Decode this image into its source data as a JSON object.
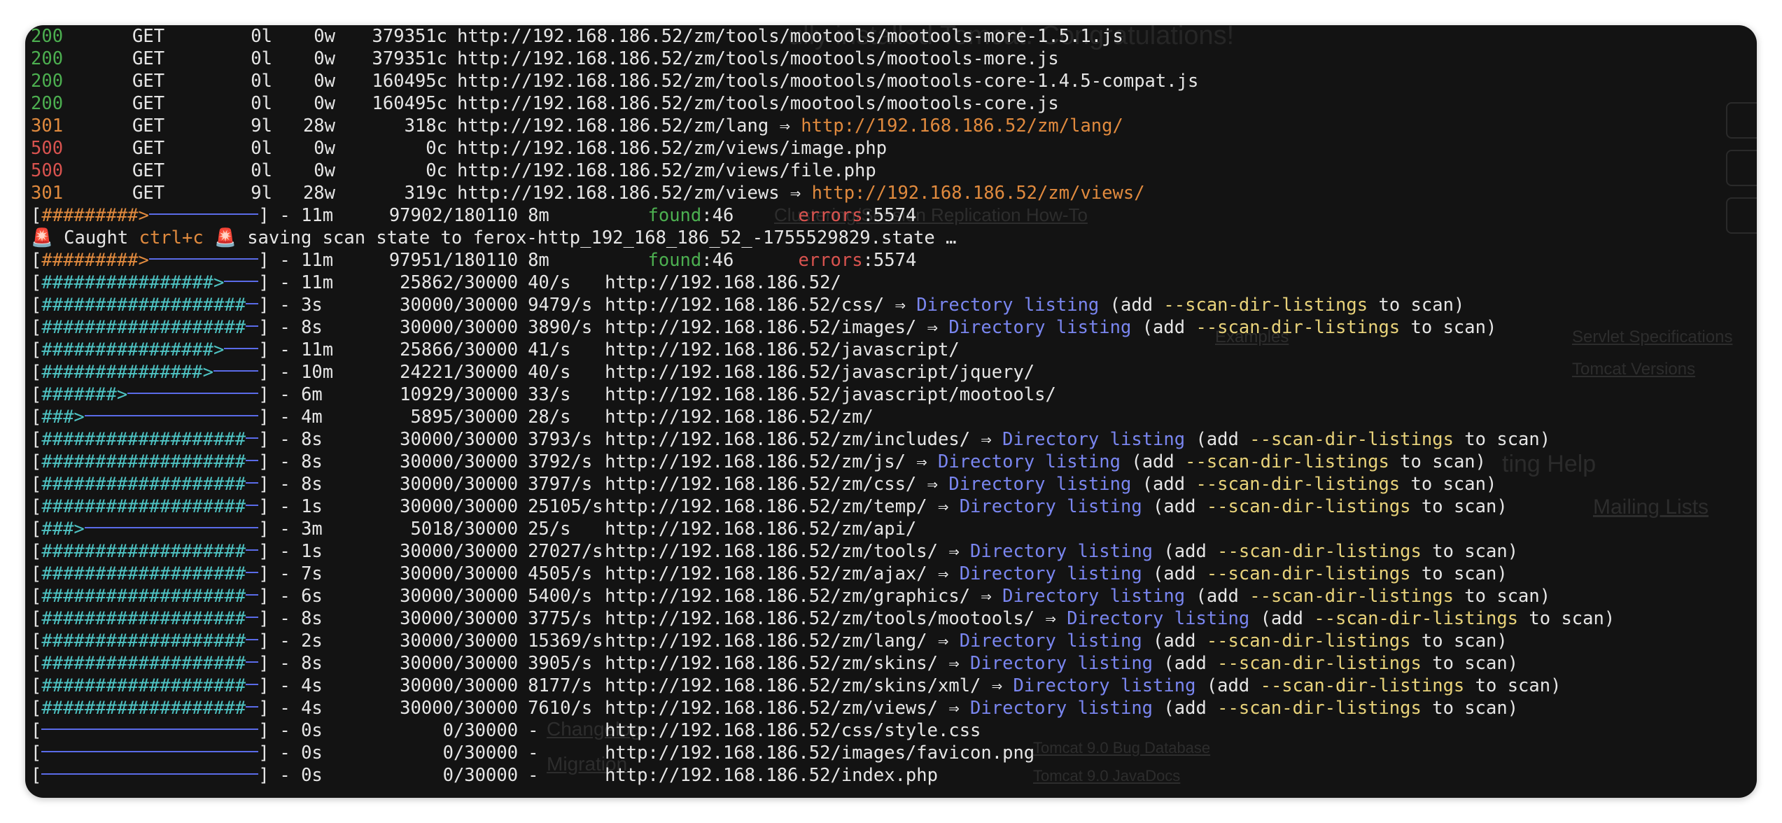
{
  "status_lines": [
    {
      "status": "200",
      "method": "GET",
      "lines": "0l",
      "words": "0w",
      "chars": "379351c",
      "url": "http://192.168.186.52/zm/tools/mootools/mootools-more-1.5.1.js",
      "redirect": ""
    },
    {
      "status": "200",
      "method": "GET",
      "lines": "0l",
      "words": "0w",
      "chars": "379351c",
      "url": "http://192.168.186.52/zm/tools/mootools/mootools-more.js",
      "redirect": ""
    },
    {
      "status": "200",
      "method": "GET",
      "lines": "0l",
      "words": "0w",
      "chars": "160495c",
      "url": "http://192.168.186.52/zm/tools/mootools/mootools-core-1.4.5-compat.js",
      "redirect": ""
    },
    {
      "status": "200",
      "method": "GET",
      "lines": "0l",
      "words": "0w",
      "chars": "160495c",
      "url": "http://192.168.186.52/zm/tools/mootools/mootools-core.js",
      "redirect": ""
    },
    {
      "status": "301",
      "method": "GET",
      "lines": "9l",
      "words": "28w",
      "chars": "318c",
      "url": "http://192.168.186.52/zm/lang",
      "redirect": "http://192.168.186.52/zm/lang/"
    },
    {
      "status": "500",
      "method": "GET",
      "lines": "0l",
      "words": "0w",
      "chars": "0c",
      "url": "http://192.168.186.52/zm/views/image.php",
      "redirect": ""
    },
    {
      "status": "500",
      "method": "GET",
      "lines": "0l",
      "words": "0w",
      "chars": "0c",
      "url": "http://192.168.186.52/zm/views/file.php",
      "redirect": ""
    },
    {
      "status": "301",
      "method": "GET",
      "lines": "9l",
      "words": "28w",
      "chars": "319c",
      "url": "http://192.168.186.52/zm/views",
      "redirect": "http://192.168.186.52/zm/views/"
    }
  ],
  "arrow": "⇒",
  "overall_1": {
    "bar_hash": "#########>",
    "bar_fraction": 0.54,
    "time": "11m",
    "count": "97902/180110",
    "rate": "8m",
    "found_label": "found",
    "found": "46",
    "errors_label": "errors",
    "errors": "5574"
  },
  "caught": {
    "siren": "🚨",
    "pre": " Caught ",
    "keys": "ctrl+c",
    "post": " saving scan state to ferox-http_192_168_186_52_-1755529829.state …"
  },
  "overall_2": {
    "bar_hash": "#########>",
    "bar_fraction": 0.54,
    "time": "11m",
    "count": "97951/180110",
    "rate": "8m",
    "found_label": "found",
    "found": "46",
    "errors_label": "errors",
    "errors": "5574"
  },
  "scans": [
    {
      "hash": "################>",
      "fraction": 0.86,
      "time": "11m",
      "count": "25862/30000",
      "rate": "40/s",
      "url": "http://192.168.186.52/",
      "dirlist": false
    },
    {
      "hash": "###################",
      "fraction": 1.0,
      "time": "3s",
      "count": "30000/30000",
      "rate": "9479/s",
      "url": "http://192.168.186.52/css/",
      "dirlist": true
    },
    {
      "hash": "###################",
      "fraction": 1.0,
      "time": "8s",
      "count": "30000/30000",
      "rate": "3890/s",
      "url": "http://192.168.186.52/images/",
      "dirlist": true
    },
    {
      "hash": "################>",
      "fraction": 0.86,
      "time": "11m",
      "count": "25866/30000",
      "rate": "41/s",
      "url": "http://192.168.186.52/javascript/",
      "dirlist": false
    },
    {
      "hash": "###############>",
      "fraction": 0.81,
      "time": "10m",
      "count": "24221/30000",
      "rate": "40/s",
      "url": "http://192.168.186.52/javascript/jquery/",
      "dirlist": false
    },
    {
      "hash": "#######>",
      "fraction": 0.36,
      "time": "6m",
      "count": "10929/30000",
      "rate": "33/s",
      "url": "http://192.168.186.52/javascript/mootools/",
      "dirlist": false
    },
    {
      "hash": "###>",
      "fraction": 0.2,
      "time": "4m",
      "count": "5895/30000",
      "rate": "28/s",
      "url": "http://192.168.186.52/zm/",
      "dirlist": false
    },
    {
      "hash": "###################",
      "fraction": 1.0,
      "time": "8s",
      "count": "30000/30000",
      "rate": "3793/s",
      "url": "http://192.168.186.52/zm/includes/",
      "dirlist": true
    },
    {
      "hash": "###################",
      "fraction": 1.0,
      "time": "8s",
      "count": "30000/30000",
      "rate": "3792/s",
      "url": "http://192.168.186.52/zm/js/",
      "dirlist": true
    },
    {
      "hash": "###################",
      "fraction": 1.0,
      "time": "8s",
      "count": "30000/30000",
      "rate": "3797/s",
      "url": "http://192.168.186.52/zm/css/",
      "dirlist": true
    },
    {
      "hash": "###################",
      "fraction": 1.0,
      "time": "1s",
      "count": "30000/30000",
      "rate": "25105/s",
      "url": "http://192.168.186.52/zm/temp/",
      "dirlist": true
    },
    {
      "hash": "###>",
      "fraction": 0.17,
      "time": "3m",
      "count": "5018/30000",
      "rate": "25/s",
      "url": "http://192.168.186.52/zm/api/",
      "dirlist": false
    },
    {
      "hash": "###################",
      "fraction": 1.0,
      "time": "1s",
      "count": "30000/30000",
      "rate": "27027/s",
      "url": "http://192.168.186.52/zm/tools/",
      "dirlist": true
    },
    {
      "hash": "###################",
      "fraction": 1.0,
      "time": "7s",
      "count": "30000/30000",
      "rate": "4505/s",
      "url": "http://192.168.186.52/zm/ajax/",
      "dirlist": true
    },
    {
      "hash": "###################",
      "fraction": 1.0,
      "time": "6s",
      "count": "30000/30000",
      "rate": "5400/s",
      "url": "http://192.168.186.52/zm/graphics/",
      "dirlist": true
    },
    {
      "hash": "###################",
      "fraction": 1.0,
      "time": "8s",
      "count": "30000/30000",
      "rate": "3775/s",
      "url": "http://192.168.186.52/zm/tools/mootools/",
      "dirlist": true
    },
    {
      "hash": "###################",
      "fraction": 1.0,
      "time": "2s",
      "count": "30000/30000",
      "rate": "15369/s",
      "url": "http://192.168.186.52/zm/lang/",
      "dirlist": true
    },
    {
      "hash": "###################",
      "fraction": 1.0,
      "time": "8s",
      "count": "30000/30000",
      "rate": "3905/s",
      "url": "http://192.168.186.52/zm/skins/",
      "dirlist": true
    },
    {
      "hash": "###################",
      "fraction": 1.0,
      "time": "4s",
      "count": "30000/30000",
      "rate": "8177/s",
      "url": "http://192.168.186.52/zm/skins/xml/",
      "dirlist": true
    },
    {
      "hash": "###################",
      "fraction": 1.0,
      "time": "4s",
      "count": "30000/30000",
      "rate": "7610/s",
      "url": "http://192.168.186.52/zm/views/",
      "dirlist": true
    },
    {
      "hash": "",
      "fraction": 0.0,
      "time": "0s",
      "count": "0/30000",
      "rate": "-",
      "url": "http://192.168.186.52/css/style.css",
      "dirlist": false
    },
    {
      "hash": "",
      "fraction": 0.0,
      "time": "0s",
      "count": "0/30000",
      "rate": "-",
      "url": "http://192.168.186.52/images/favicon.png",
      "dirlist": false
    },
    {
      "hash": "",
      "fraction": 0.0,
      "time": "0s",
      "count": "0/30000",
      "rate": "-",
      "url": "http://192.168.186.52/index.php",
      "dirlist": false
    }
  ],
  "dirlist_text": "Directory listing",
  "dirlist_pre": "(add ",
  "dirlist_flag": "--scan-dir-listings",
  "dirlist_post": " to scan)",
  "background_page": {
    "title": "ully installed Tomcat. Congratulations!",
    "links": [
      "Clustering/Session Replication How-To",
      "Examples",
      "Servlet Specifications",
      "Tomcat Versions",
      "Mailing Lists",
      "Tomcat 9.0 Bug Database",
      "Tomcat 9.0 JavaDocs",
      "Changelog",
      "Migration",
      "ting Help"
    ]
  }
}
